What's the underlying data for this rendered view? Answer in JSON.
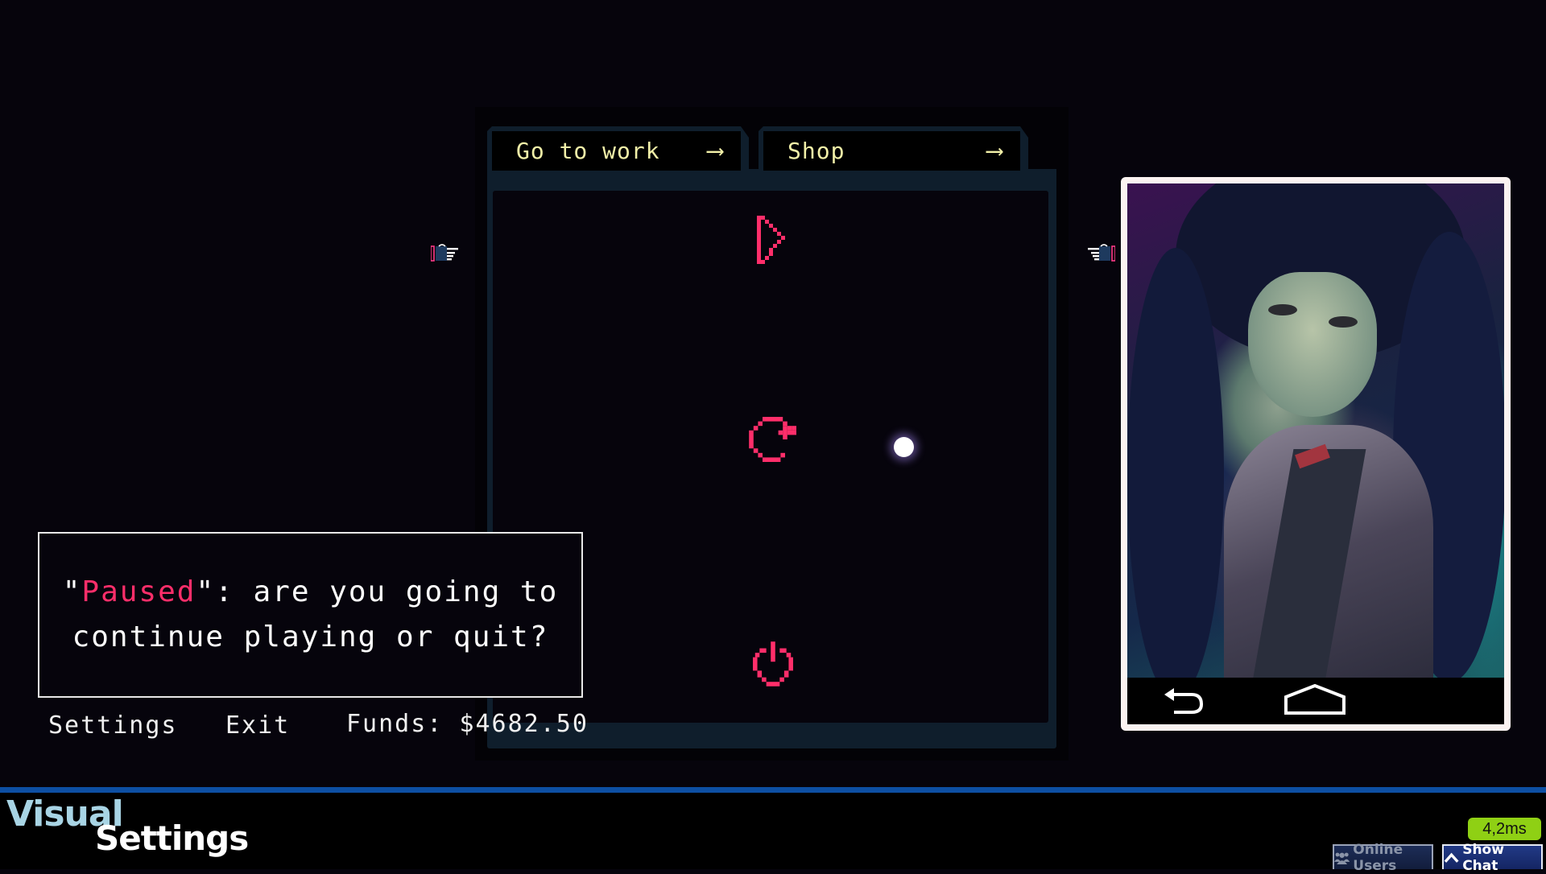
{
  "colors": {
    "accent_pink": "#ff2e6a",
    "tab_text": "#f2f0a8",
    "panel_teal": "#0f1e2c",
    "bottom_blue": "#0d4fa3",
    "ping_green": "#8fd014"
  },
  "tabs": [
    {
      "label": "Go to work",
      "arrow": "⟶"
    },
    {
      "label": "Shop",
      "arrow": "⟶"
    }
  ],
  "center_menu": {
    "icons": [
      "play-icon",
      "restart-icon",
      "power-icon"
    ]
  },
  "cursor": {
    "icon": "glowing-dot-cursor"
  },
  "pointers": {
    "left": "pointing-hand-right-icon",
    "right": "pointing-hand-left-icon"
  },
  "dialog": {
    "open_quote": "\"",
    "highlight": "Paused",
    "close_quote_colon": "\":",
    "line1_rest": " are you going to",
    "line2": "continue playing or quit?"
  },
  "footer_menu": {
    "settings": "Settings",
    "exit": "Exit",
    "funds_label": "Funds:",
    "funds_value": "$4682.50"
  },
  "phone": {
    "image": "anime-girl-portrait",
    "nav": [
      "back-icon",
      "home-icon"
    ]
  },
  "overlay": {
    "title_line1": "Visual",
    "title_line2": "Settings",
    "ping": "4,2ms",
    "online_users": "Online Users",
    "show_chat": "Show Chat"
  }
}
